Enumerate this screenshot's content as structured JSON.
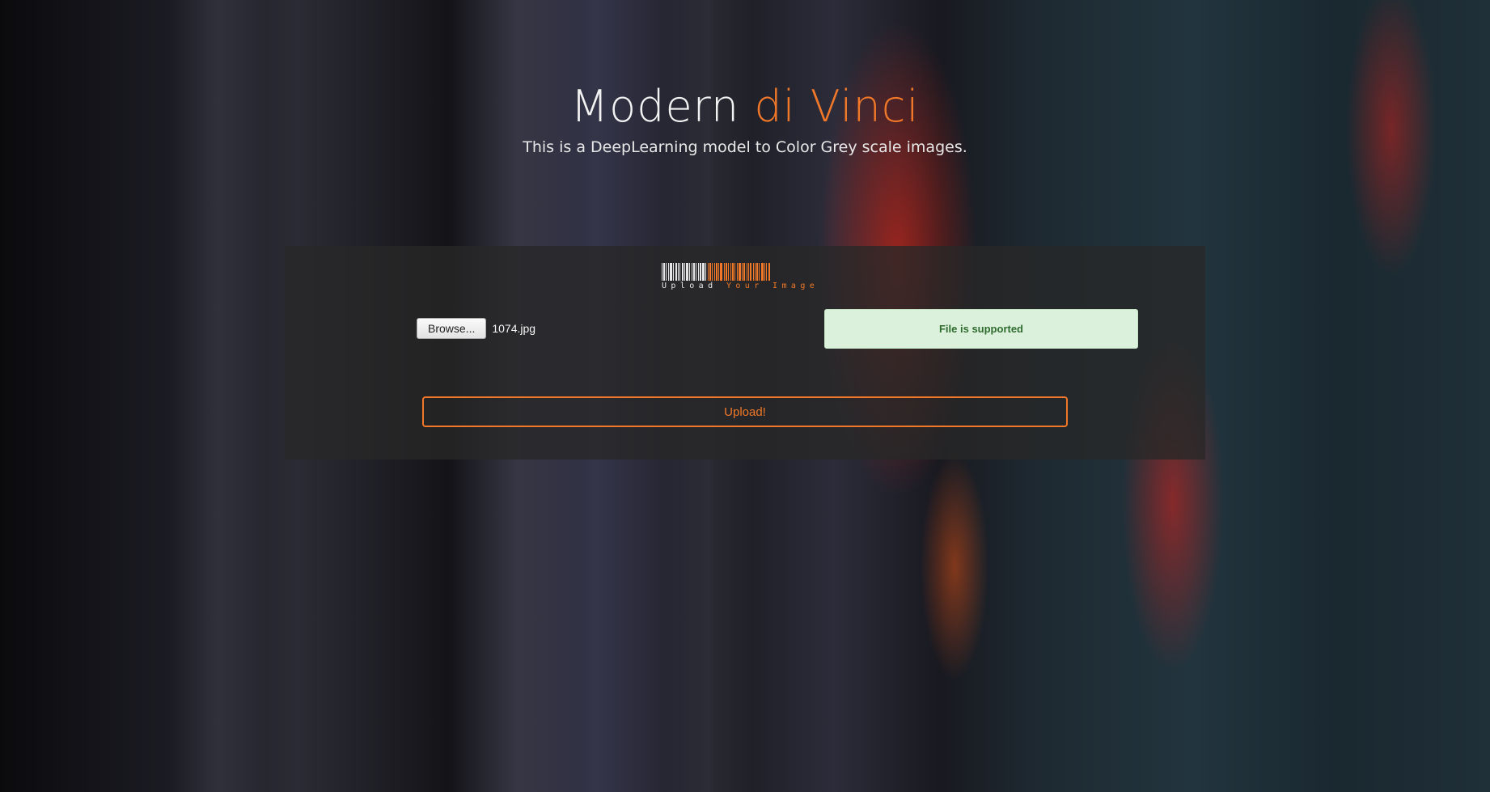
{
  "header": {
    "title_main": "Modern",
    "title_accent": "di Vinci",
    "subtitle": "This is a DeepLearning model to Color Grey scale images."
  },
  "upload_panel": {
    "logo_text_main": "Upload",
    "logo_text_accent": "Your Image",
    "browse_label": "Browse...",
    "file_name": "1074.jpg",
    "status_text": "File is supported",
    "upload_label": "Upload!"
  },
  "colors": {
    "accent": "#f07828",
    "status_bg": "#dcf1dc",
    "status_text": "#2e6b2e",
    "panel_bg": "rgba(40,40,40,0.78)"
  }
}
